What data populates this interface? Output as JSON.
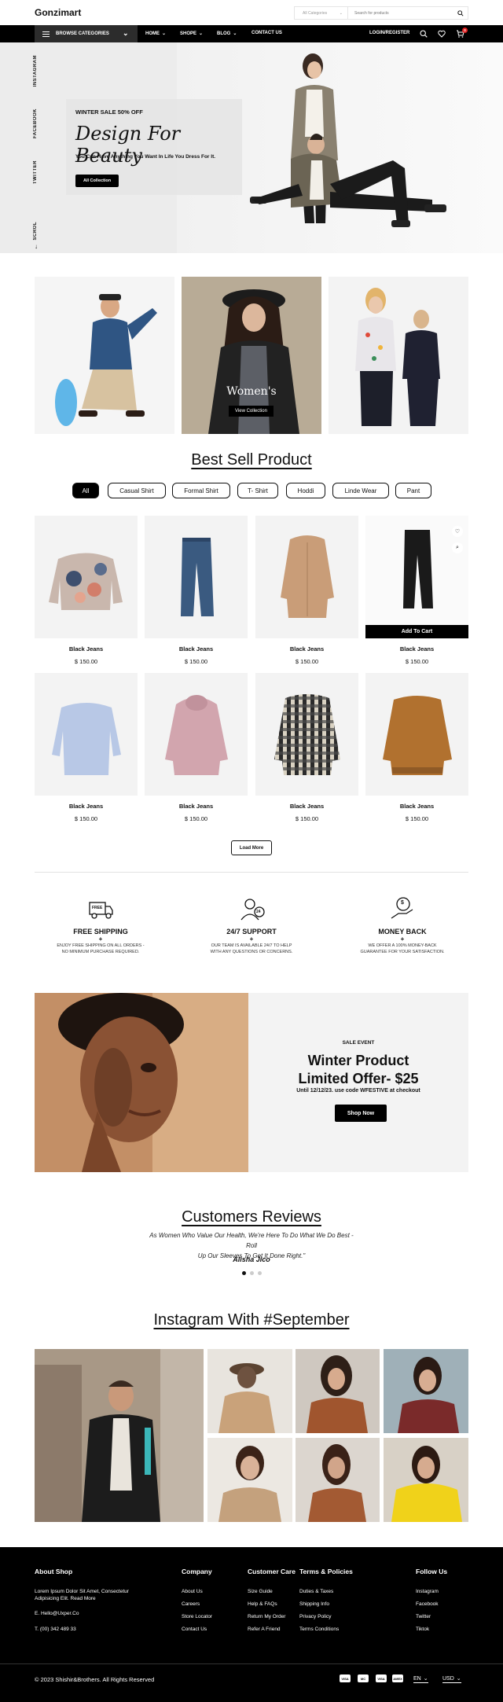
{
  "header": {
    "logo": "Gonzimart",
    "search_category": "All Categories",
    "search_placeholder": "Search for products"
  },
  "nav": {
    "browse": "BROWSE CATEGORIES",
    "items": [
      "HOME",
      "SHOPE",
      "BLOG",
      "CONTACT US"
    ],
    "login": "LOGIN/REGISTER",
    "cart_count": "0"
  },
  "hero": {
    "social": [
      "INSTAGRAM",
      "FACEBOOK",
      "TWITTER"
    ],
    "scroll": "SCROL",
    "sale": "WINTER SALE 50% OFF",
    "title": "Design For Beauty",
    "subtitle": "You Can Have Anything You Want In Life You Dress For It.",
    "button": "All Collection"
  },
  "categories": {
    "middle_label": "Women's",
    "middle_button": "View Collection"
  },
  "best_sell": {
    "title": "Best Sell Product",
    "filters": [
      "All",
      "Casual Shirt",
      "Formal Shirt",
      "T- Shirt",
      "Hoddi",
      "Linde Wear",
      "Pant"
    ],
    "add_to_cart": "Add To Cart",
    "products": [
      {
        "name": "Black Jeans",
        "price": "$ 150.00"
      },
      {
        "name": "Black Jeans",
        "price": "$ 150.00"
      },
      {
        "name": "Black Jeans",
        "price": "$ 150.00"
      },
      {
        "name": "Black Jeans",
        "price": "$ 150.00"
      },
      {
        "name": "Black Jeans",
        "price": "$ 150.00"
      },
      {
        "name": "Black Jeans",
        "price": "$ 150.00"
      },
      {
        "name": "Black Jeans",
        "price": "$ 150.00"
      },
      {
        "name": "Black Jeans",
        "price": "$ 150.00"
      }
    ],
    "load_more": "Load More"
  },
  "features": [
    {
      "title": "FREE SHIPPING",
      "desc1": "ENJOY FREE SHIPPING ON ALL ORDERS -",
      "desc2": "NO MINIMUM PURCHASE REQUIRED.",
      "icon": "truck-icon",
      "badge": "FREE"
    },
    {
      "title": "24/7 SUPPORT",
      "desc1": "OUR TEAM IS AVAILABLE 24/7 TO HELP",
      "desc2": "WITH ANY QUESTIONS OR CONCERNS.",
      "icon": "support-icon",
      "badge": "24"
    },
    {
      "title": "MONEY BACK",
      "desc1": "WE OFFER A 100% MONEY-BACK",
      "desc2": "GUARANTEE FOR YOUR SATISFACTION.",
      "icon": "money-back-icon",
      "badge": "$"
    }
  ],
  "promo": {
    "event": "SALE EVENT",
    "title1": "Winter Product",
    "title2": "Limited Offer- $25",
    "sub": "Until 12/12/23. use code WFESTIVE at checkout",
    "button": "Shop Now"
  },
  "reviews": {
    "title": "Customers Reviews",
    "text1": "As Women Who Value Our Health, We're Here To Do What We Do Best - Roll",
    "text2": "Up Our Sleeves To Get It Done Right.\"",
    "author": "Alisha Jico"
  },
  "instagram": {
    "title": "Instagram With #September"
  },
  "footer": {
    "about_title": "About Shop",
    "about_text1": "Lorem Ipsum Dolor Sit Amet, Consectetur",
    "about_text2": "Adipisicing Elit. Read More",
    "email": "E. Hello@Uxper.Co",
    "phone": "T. (00) 342 489 33",
    "company_title": "Company",
    "company_links": [
      "About Us",
      "Careers",
      "Store Locator",
      "Contact Us"
    ],
    "care_title": "Customer Care",
    "care_links": [
      "Size Guide",
      "Help & FAQs",
      "Return My Order",
      "Refer A Friend"
    ],
    "terms_title": "Terms & Policies",
    "terms_links": [
      "Duties & Taxes",
      "Shipping Info",
      "Privacy Policy",
      "Terms Conditions"
    ],
    "follow_title": "Follow Us",
    "follow_links": [
      "Instagram",
      "Facebook",
      "Twitter",
      "Tiktok"
    ],
    "copyright": "© 2023 Shishir&Brothers. All Rights Reserved",
    "payments": [
      "VISA",
      "MC",
      "VISA",
      "AMEX"
    ],
    "language": "EN",
    "currency": "USD"
  }
}
